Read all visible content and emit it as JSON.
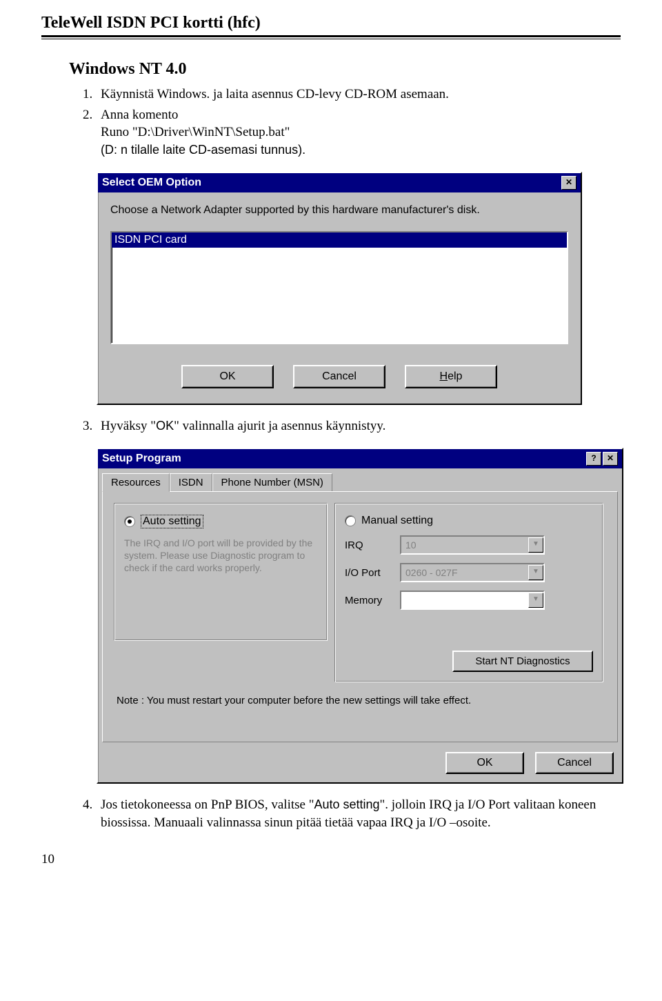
{
  "header": {
    "title": "TeleWell ISDN PCI kortti (hfc)"
  },
  "section": {
    "title": "Windows NT 4.0"
  },
  "steps": {
    "s1_a": "Käynnistä Windows. ja laita asennus CD-levy CD-ROM asemaan.",
    "s2_a": "Anna komento",
    "s2_b": "Runo \"D:\\Driver\\WinNT\\Setup.bat\"",
    "s2_c": "(D: n tilalle laite CD-asemasi tunnus).",
    "s3_a": "Hyväksy \"OK\" valinnalla ajurit ja asennus käynnistyy.",
    "s4_a": "Jos tietokoneessa on PnP BIOS, valitse \"Auto setting\". jolloin IRQ ja I/O Port valitaan koneen biossissa. Manuaali valinnassa sinun pitää tietää vapaa IRQ ja I/O –osoite."
  },
  "dialog1": {
    "title": "Select OEM Option",
    "prompt": "Choose a Network Adapter supported by this hardware manufacturer's disk.",
    "selected_item": "ISDN PCI card",
    "ok": "OK",
    "cancel": "Cancel",
    "help": "Help",
    "close_glyph": "✕"
  },
  "dialog2": {
    "title": "Setup Program",
    "help_glyph": "?",
    "close_glyph": "✕",
    "tabs": [
      "Resources",
      "ISDN",
      "Phone Number (MSN)"
    ],
    "auto_label": "Auto setting",
    "manual_label": "Manual setting",
    "auto_desc": "The IRQ and I/O port will be provided by the system.  Please use Diagnostic program to check if the card works properly.",
    "irq_label": "IRQ",
    "irq_value": "10",
    "ioport_label": "I/O Port",
    "ioport_value": "0260 - 027F",
    "memory_label": "Memory",
    "memory_value": "",
    "diag_button": "Start NT Diagnostics",
    "note": "Note : You must restart your computer before the new settings will take effect.",
    "ok": "OK",
    "cancel": "Cancel"
  },
  "page_number": "10"
}
